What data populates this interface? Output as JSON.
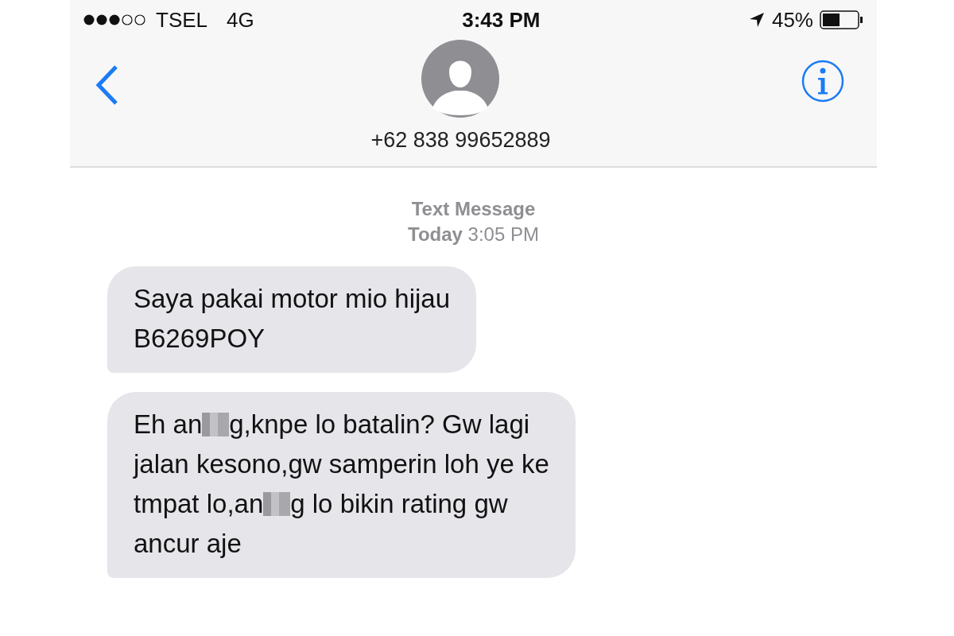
{
  "status_bar": {
    "carrier": "TSEL",
    "network": "4G",
    "time": "3:43 PM",
    "battery": "45%"
  },
  "header": {
    "contact": "+62 838 99652889"
  },
  "timestamp": {
    "label": "Text Message",
    "time": "**Today** 3:05 PM"
  },
  "messages": [
    {
      "parts": [
        {
          "kind": "text",
          "text": "Saya pakai motor mio hijau\nB6269POY"
        }
      ]
    },
    {
      "parts": [
        {
          "kind": "text",
          "text": "Eh an"
        },
        {
          "kind": "censored"
        },
        {
          "kind": "text",
          "text": "g,knpe lo batalin? Gw lagi\njalan kesono,gw samperin loh ye ke\ntmpat lo,an"
        },
        {
          "kind": "censored"
        },
        {
          "kind": "text",
          "text": "g lo bikin rating gw\nancur aje"
        }
      ]
    }
  ]
}
